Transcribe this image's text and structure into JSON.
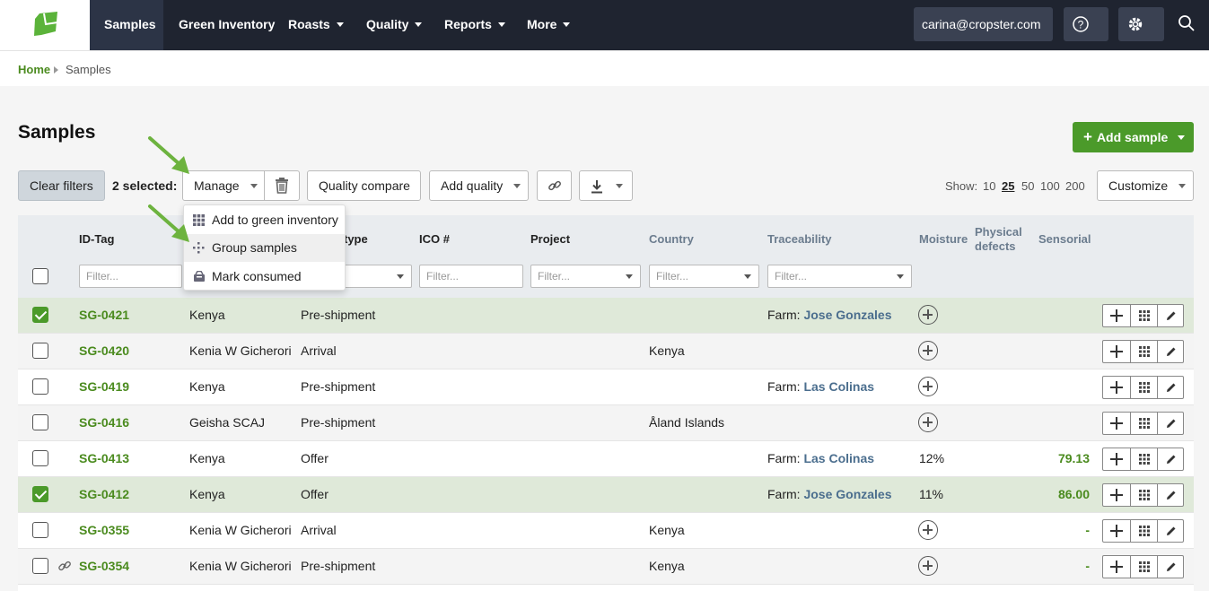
{
  "nav": {
    "items": [
      {
        "label": "Samples",
        "active": true
      },
      {
        "label": "Green Inventory"
      },
      {
        "label": "Roasts"
      },
      {
        "label": "Quality"
      },
      {
        "label": "Reports"
      },
      {
        "label": "More"
      }
    ],
    "user": "carina@cropster.com",
    "help_icon": "question-circle-icon",
    "settings_icon": "gear-icon",
    "search_icon": "search-icon"
  },
  "breadcrumb": {
    "home": "Home",
    "current": "Samples"
  },
  "page": {
    "title": "Samples",
    "add_sample": "Add sample"
  },
  "toolbar": {
    "clear_filters": "Clear filters",
    "selected": "2 selected:",
    "manage": "Manage",
    "quality_compare": "Quality compare",
    "add_quality": "Add quality",
    "show_label": "Show:",
    "show_options": [
      "10",
      "25",
      "50",
      "100",
      "200"
    ],
    "show_active": "25",
    "customize": "Customize"
  },
  "manage_menu": [
    {
      "label": "Add to green inventory",
      "icon": "grid-icon"
    },
    {
      "label": "Group samples",
      "icon": "group-icon",
      "hover": true
    },
    {
      "label": "Mark consumed",
      "icon": "consumed-icon"
    }
  ],
  "columns": {
    "id_tag": "ID-Tag",
    "sample_type": "type",
    "ico": "ICO #",
    "project": "Project",
    "country": "Country",
    "traceability": "Traceability",
    "moisture": "Moisture",
    "physical_defects_1": "Physical",
    "physical_defects_2": "defects",
    "sensorial": "Sensorial",
    "filter_placeholder": "Filter..."
  },
  "rows": [
    {
      "id": "SG-0421",
      "name": "Kenya",
      "type": "Pre-shipment",
      "country": "",
      "farm_prefix": "Farm: ",
      "farm": "Jose Gonzales",
      "moisture": "",
      "sensorial": "",
      "selected": true
    },
    {
      "id": "SG-0420",
      "name": "Kenia W Gicherori",
      "type": "Arrival",
      "country": "Kenya",
      "farm_prefix": "",
      "farm": "",
      "moisture": "",
      "sensorial": "",
      "selected": false
    },
    {
      "id": "SG-0419",
      "name": "Kenya",
      "type": "Pre-shipment",
      "country": "",
      "farm_prefix": "Farm: ",
      "farm": "Las Colinas",
      "moisture": "",
      "sensorial": "",
      "selected": false
    },
    {
      "id": "SG-0416",
      "name": "Geisha SCAJ",
      "type": "Pre-shipment",
      "country": "Åland Islands",
      "farm_prefix": "",
      "farm": "",
      "moisture": "",
      "sensorial": "",
      "selected": false
    },
    {
      "id": "SG-0413",
      "name": "Kenya",
      "type": "Offer",
      "country": "",
      "farm_prefix": "Farm: ",
      "farm": "Las Colinas",
      "moisture": "12%",
      "sensorial": "79.13",
      "selected": false
    },
    {
      "id": "SG-0412",
      "name": "Kenya",
      "type": "Offer",
      "country": "",
      "farm_prefix": "Farm: ",
      "farm": "Jose Gonzales",
      "moisture": "11%",
      "sensorial": "86.00",
      "selected": true
    },
    {
      "id": "SG-0355",
      "name": "Kenia W Gicherori",
      "type": "Arrival",
      "country": "Kenya",
      "farm_prefix": "",
      "farm": "",
      "moisture": "",
      "sensorial": "-",
      "selected": false
    },
    {
      "id": "SG-0354",
      "name": "Kenia W Gicherori",
      "type": "Pre-shipment",
      "country": "Kenya",
      "farm_prefix": "",
      "farm": "",
      "moisture": "",
      "sensorial": "-",
      "selected": false,
      "linked": true
    }
  ],
  "colors": {
    "brand_green": "#4b9a2a",
    "nav_bg": "#1f2430",
    "selected_row": "#dfe9d9",
    "arrow": "#6db33f"
  }
}
